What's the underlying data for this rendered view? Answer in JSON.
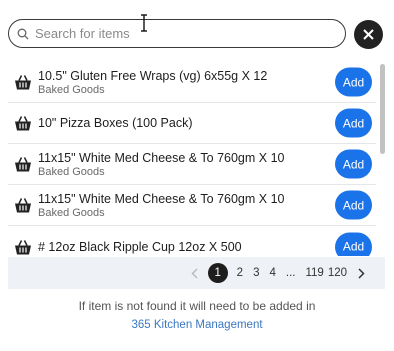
{
  "search": {
    "placeholder": "Search for items",
    "value": ""
  },
  "close_icon": "close-icon",
  "items": [
    {
      "name": "10.5\" Gluten Free Wraps (vg) 6x55g X 12",
      "category": "Baked Goods",
      "add_label": "Add"
    },
    {
      "name": "10\" Pizza Boxes (100 Pack)",
      "category": "",
      "add_label": "Add"
    },
    {
      "name": "11x15\" White Med Cheese & To 760gm X 10",
      "category": "Baked Goods",
      "add_label": "Add"
    },
    {
      "name": "11x15\" White Med Cheese & To 760gm X 10",
      "category": "Baked Goods",
      "add_label": "Add"
    },
    {
      "name": "# 12oz Black Ripple Cup 12oz X 500",
      "category": "",
      "add_label": "Add"
    }
  ],
  "pagination": {
    "current": "1",
    "pages": [
      "2",
      "3",
      "4"
    ],
    "ellipsis": "...",
    "last_pages": [
      "119",
      "120"
    ]
  },
  "footer": {
    "note": "If item is not found it will need to be added in",
    "link": "365 Kitchen Management"
  },
  "colors": {
    "accent": "#1a73e8",
    "link": "#3b78c2",
    "pager_bg": "#eef1f5"
  }
}
